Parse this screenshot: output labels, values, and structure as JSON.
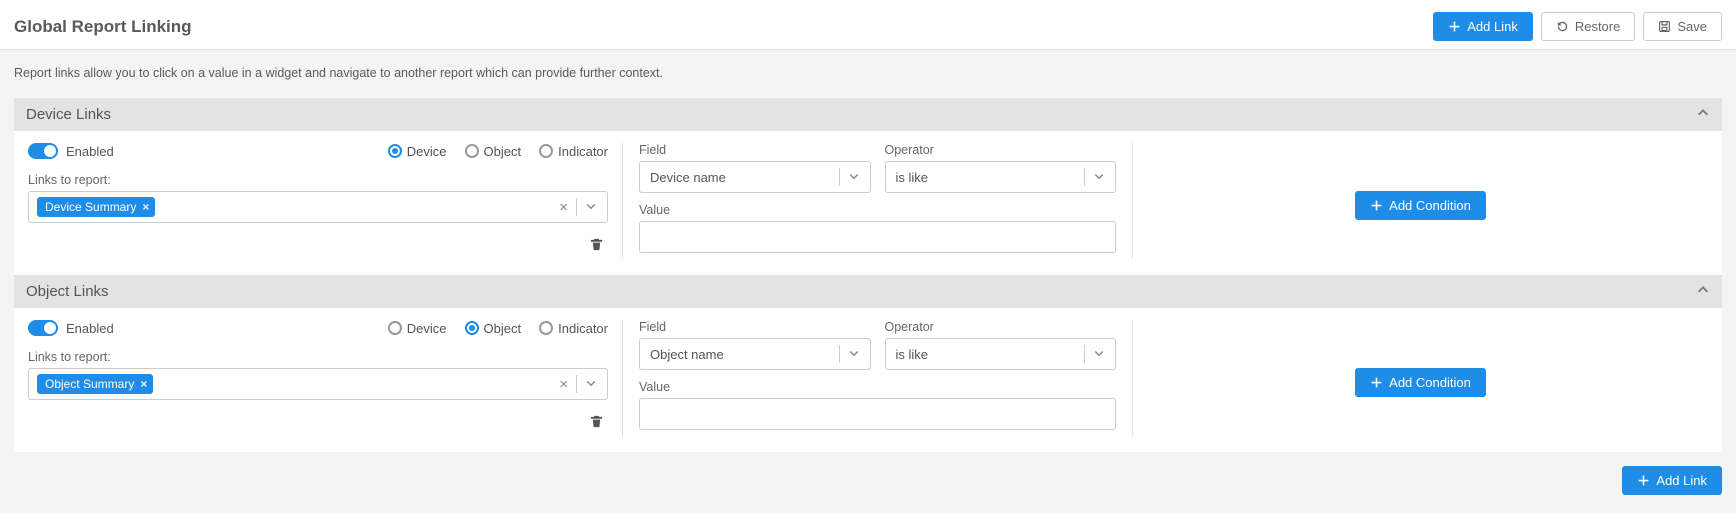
{
  "header": {
    "title": "Global Report Linking",
    "add_link": "Add Link",
    "restore": "Restore",
    "save": "Save"
  },
  "description": "Report links allow you to click on a value in a widget and navigate to another report which can provide further context.",
  "radio_labels": {
    "device": "Device",
    "object": "Object",
    "indicator": "Indicator"
  },
  "labels": {
    "enabled": "Enabled",
    "links_to_report": "Links to report:",
    "field": "Field",
    "operator": "Operator",
    "value": "Value",
    "add_condition": "Add Condition"
  },
  "sections": [
    {
      "title": "Device Links",
      "enabled": true,
      "radio_selected": "device",
      "report_tag": "Device Summary",
      "condition": {
        "field": "Device name",
        "operator": "is like",
        "value": ""
      }
    },
    {
      "title": "Object Links",
      "enabled": true,
      "radio_selected": "object",
      "report_tag": "Object Summary",
      "condition": {
        "field": "Object name",
        "operator": "is like",
        "value": ""
      }
    }
  ],
  "footer": {
    "add_link": "Add Link"
  }
}
